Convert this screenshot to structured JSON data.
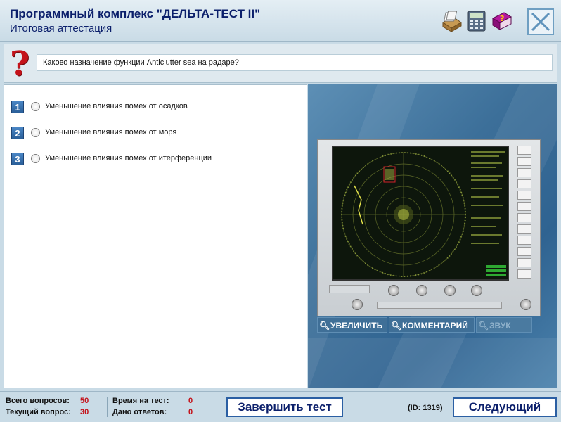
{
  "header": {
    "title": "Программный комплекс \"ДЕЛЬТА-ТЕСТ II\"",
    "subtitle": "Итоговая аттестация",
    "icons": [
      "card-file-icon",
      "calculator-icon",
      "help-book-icon",
      "close-icon"
    ]
  },
  "question": {
    "text": "Каково назначение функции Anticlutter sea на радаре?"
  },
  "answers": [
    {
      "number": "1",
      "label": "Уменьшение влияния помех от осадков"
    },
    {
      "number": "2",
      "label": "Уменьшение влияния помех от моря"
    },
    {
      "number": "3",
      "label": "Уменьшение влияния помех от итерференции"
    }
  ],
  "image_buttons": {
    "zoom": "УВЕЛИЧИТЬ",
    "comments": "КОММЕНТАРИЙ",
    "sound": "ЗВУК"
  },
  "footer": {
    "total_label": "Всего вопросов:",
    "total_value": "50",
    "current_label": "Текущий вопрос:",
    "current_value": "30",
    "time_label": "Время на тест:",
    "time_value": "0",
    "answered_label": "Дано ответов:",
    "answered_value": "0",
    "finish_button": "Завершить тест",
    "id_text": "(ID: 1319)",
    "next_button": "Следующий"
  },
  "colors": {
    "accent": "#0b1f6b",
    "question_mark": "#c4121a",
    "radar_green": "#c8d24a"
  }
}
